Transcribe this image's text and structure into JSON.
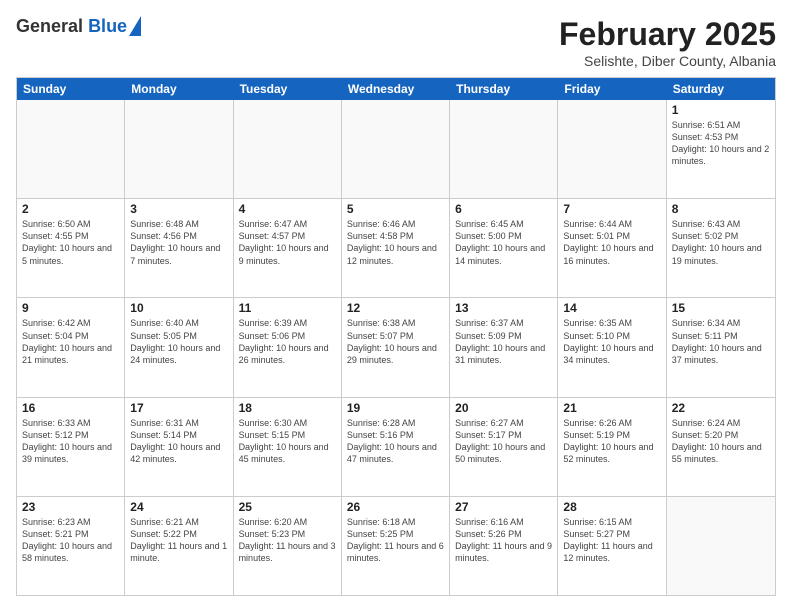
{
  "header": {
    "logo_general": "General",
    "logo_blue": "Blue",
    "title": "February 2025",
    "subtitle": "Selishte, Diber County, Albania"
  },
  "weekdays": [
    "Sunday",
    "Monday",
    "Tuesday",
    "Wednesday",
    "Thursday",
    "Friday",
    "Saturday"
  ],
  "weeks": [
    [
      {
        "day": "",
        "info": ""
      },
      {
        "day": "",
        "info": ""
      },
      {
        "day": "",
        "info": ""
      },
      {
        "day": "",
        "info": ""
      },
      {
        "day": "",
        "info": ""
      },
      {
        "day": "",
        "info": ""
      },
      {
        "day": "1",
        "info": "Sunrise: 6:51 AM\nSunset: 4:53 PM\nDaylight: 10 hours and 2 minutes."
      }
    ],
    [
      {
        "day": "2",
        "info": "Sunrise: 6:50 AM\nSunset: 4:55 PM\nDaylight: 10 hours and 5 minutes."
      },
      {
        "day": "3",
        "info": "Sunrise: 6:48 AM\nSunset: 4:56 PM\nDaylight: 10 hours and 7 minutes."
      },
      {
        "day": "4",
        "info": "Sunrise: 6:47 AM\nSunset: 4:57 PM\nDaylight: 10 hours and 9 minutes."
      },
      {
        "day": "5",
        "info": "Sunrise: 6:46 AM\nSunset: 4:58 PM\nDaylight: 10 hours and 12 minutes."
      },
      {
        "day": "6",
        "info": "Sunrise: 6:45 AM\nSunset: 5:00 PM\nDaylight: 10 hours and 14 minutes."
      },
      {
        "day": "7",
        "info": "Sunrise: 6:44 AM\nSunset: 5:01 PM\nDaylight: 10 hours and 16 minutes."
      },
      {
        "day": "8",
        "info": "Sunrise: 6:43 AM\nSunset: 5:02 PM\nDaylight: 10 hours and 19 minutes."
      }
    ],
    [
      {
        "day": "9",
        "info": "Sunrise: 6:42 AM\nSunset: 5:04 PM\nDaylight: 10 hours and 21 minutes."
      },
      {
        "day": "10",
        "info": "Sunrise: 6:40 AM\nSunset: 5:05 PM\nDaylight: 10 hours and 24 minutes."
      },
      {
        "day": "11",
        "info": "Sunrise: 6:39 AM\nSunset: 5:06 PM\nDaylight: 10 hours and 26 minutes."
      },
      {
        "day": "12",
        "info": "Sunrise: 6:38 AM\nSunset: 5:07 PM\nDaylight: 10 hours and 29 minutes."
      },
      {
        "day": "13",
        "info": "Sunrise: 6:37 AM\nSunset: 5:09 PM\nDaylight: 10 hours and 31 minutes."
      },
      {
        "day": "14",
        "info": "Sunrise: 6:35 AM\nSunset: 5:10 PM\nDaylight: 10 hours and 34 minutes."
      },
      {
        "day": "15",
        "info": "Sunrise: 6:34 AM\nSunset: 5:11 PM\nDaylight: 10 hours and 37 minutes."
      }
    ],
    [
      {
        "day": "16",
        "info": "Sunrise: 6:33 AM\nSunset: 5:12 PM\nDaylight: 10 hours and 39 minutes."
      },
      {
        "day": "17",
        "info": "Sunrise: 6:31 AM\nSunset: 5:14 PM\nDaylight: 10 hours and 42 minutes."
      },
      {
        "day": "18",
        "info": "Sunrise: 6:30 AM\nSunset: 5:15 PM\nDaylight: 10 hours and 45 minutes."
      },
      {
        "day": "19",
        "info": "Sunrise: 6:28 AM\nSunset: 5:16 PM\nDaylight: 10 hours and 47 minutes."
      },
      {
        "day": "20",
        "info": "Sunrise: 6:27 AM\nSunset: 5:17 PM\nDaylight: 10 hours and 50 minutes."
      },
      {
        "day": "21",
        "info": "Sunrise: 6:26 AM\nSunset: 5:19 PM\nDaylight: 10 hours and 52 minutes."
      },
      {
        "day": "22",
        "info": "Sunrise: 6:24 AM\nSunset: 5:20 PM\nDaylight: 10 hours and 55 minutes."
      }
    ],
    [
      {
        "day": "23",
        "info": "Sunrise: 6:23 AM\nSunset: 5:21 PM\nDaylight: 10 hours and 58 minutes."
      },
      {
        "day": "24",
        "info": "Sunrise: 6:21 AM\nSunset: 5:22 PM\nDaylight: 11 hours and 1 minute."
      },
      {
        "day": "25",
        "info": "Sunrise: 6:20 AM\nSunset: 5:23 PM\nDaylight: 11 hours and 3 minutes."
      },
      {
        "day": "26",
        "info": "Sunrise: 6:18 AM\nSunset: 5:25 PM\nDaylight: 11 hours and 6 minutes."
      },
      {
        "day": "27",
        "info": "Sunrise: 6:16 AM\nSunset: 5:26 PM\nDaylight: 11 hours and 9 minutes."
      },
      {
        "day": "28",
        "info": "Sunrise: 6:15 AM\nSunset: 5:27 PM\nDaylight: 11 hours and 12 minutes."
      },
      {
        "day": "",
        "info": ""
      }
    ]
  ]
}
